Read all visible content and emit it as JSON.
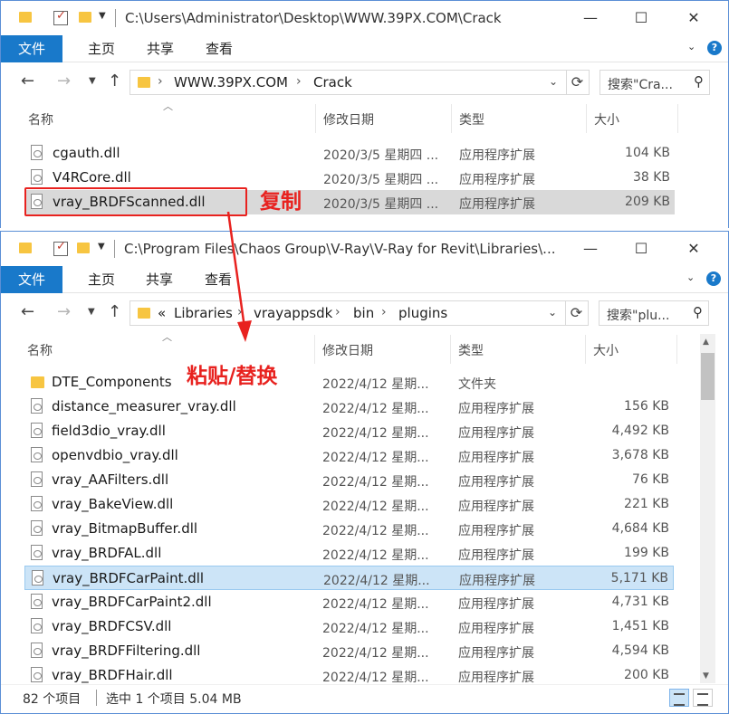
{
  "window1": {
    "title_path": "C:\\Users\\Administrator\\Desktop\\WWW.39PX.COM\\Crack",
    "ribbon": {
      "file": "文件",
      "home": "主页",
      "share": "共享",
      "view": "查看"
    },
    "breadcrumb": [
      "WWW.39PX.COM",
      "Crack"
    ],
    "search_placeholder": "搜索\"Cra...",
    "columns": {
      "name": "名称",
      "date": "修改日期",
      "type": "类型",
      "size": "大小"
    },
    "files": [
      {
        "name": "cgauth.dll",
        "date": "2020/3/5 星期四 ...",
        "type": "应用程序扩展",
        "size": "104 KB"
      },
      {
        "name": "V4RCore.dll",
        "date": "2020/3/5 星期四 ...",
        "type": "应用程序扩展",
        "size": "38 KB"
      },
      {
        "name": "vray_BRDFScanned.dll",
        "date": "2020/3/5 星期四 ...",
        "type": "应用程序扩展",
        "size": "209 KB"
      }
    ]
  },
  "window2": {
    "title_path": "C:\\Program Files\\Chaos Group\\V-Ray\\V-Ray for Revit\\Libraries\\...",
    "ribbon": {
      "file": "文件",
      "home": "主页",
      "share": "共享",
      "view": "查看"
    },
    "breadcrumb": [
      "«",
      "Libraries",
      "vrayappsdk",
      "bin",
      "plugins"
    ],
    "search_placeholder": "搜索\"plu...",
    "columns": {
      "name": "名称",
      "date": "修改日期",
      "type": "类型",
      "size": "大小"
    },
    "files": [
      {
        "name": "DTE_Components",
        "date": "2022/4/12 星期...",
        "type": "文件夹",
        "size": "",
        "folder": true
      },
      {
        "name": "distance_measurer_vray.dll",
        "date": "2022/4/12 星期...",
        "type": "应用程序扩展",
        "size": "156 KB"
      },
      {
        "name": "field3dio_vray.dll",
        "date": "2022/4/12 星期...",
        "type": "应用程序扩展",
        "size": "4,492 KB"
      },
      {
        "name": "openvdbio_vray.dll",
        "date": "2022/4/12 星期...",
        "type": "应用程序扩展",
        "size": "3,678 KB"
      },
      {
        "name": "vray_AAFilters.dll",
        "date": "2022/4/12 星期...",
        "type": "应用程序扩展",
        "size": "76 KB"
      },
      {
        "name": "vray_BakeView.dll",
        "date": "2022/4/12 星期...",
        "type": "应用程序扩展",
        "size": "221 KB"
      },
      {
        "name": "vray_BitmapBuffer.dll",
        "date": "2022/4/12 星期...",
        "type": "应用程序扩展",
        "size": "4,684 KB"
      },
      {
        "name": "vray_BRDFAL.dll",
        "date": "2022/4/12 星期...",
        "type": "应用程序扩展",
        "size": "199 KB"
      },
      {
        "name": "vray_BRDFCarPaint.dll",
        "date": "2022/4/12 星期...",
        "type": "应用程序扩展",
        "size": "5,171 KB"
      },
      {
        "name": "vray_BRDFCarPaint2.dll",
        "date": "2022/4/12 星期...",
        "type": "应用程序扩展",
        "size": "4,731 KB"
      },
      {
        "name": "vray_BRDFCSV.dll",
        "date": "2022/4/12 星期...",
        "type": "应用程序扩展",
        "size": "1,451 KB"
      },
      {
        "name": "vray_BRDFFiltering.dll",
        "date": "2022/4/12 星期...",
        "type": "应用程序扩展",
        "size": "4,594 KB"
      },
      {
        "name": "vray_BRDFHair.dll",
        "date": "2022/4/12 星期...",
        "type": "应用程序扩展",
        "size": "200 KB"
      }
    ],
    "status": {
      "count": "82 个项目",
      "selection": "选中 1 个项目  5.04 MB"
    }
  },
  "annotations": {
    "copy": "复制",
    "paste": "粘贴/替换"
  },
  "colors": {
    "accent": "#1979ca",
    "annotation": "#e8221f",
    "selection_blue": "#cce4f7",
    "selection_grey": "#d9d9d9"
  }
}
